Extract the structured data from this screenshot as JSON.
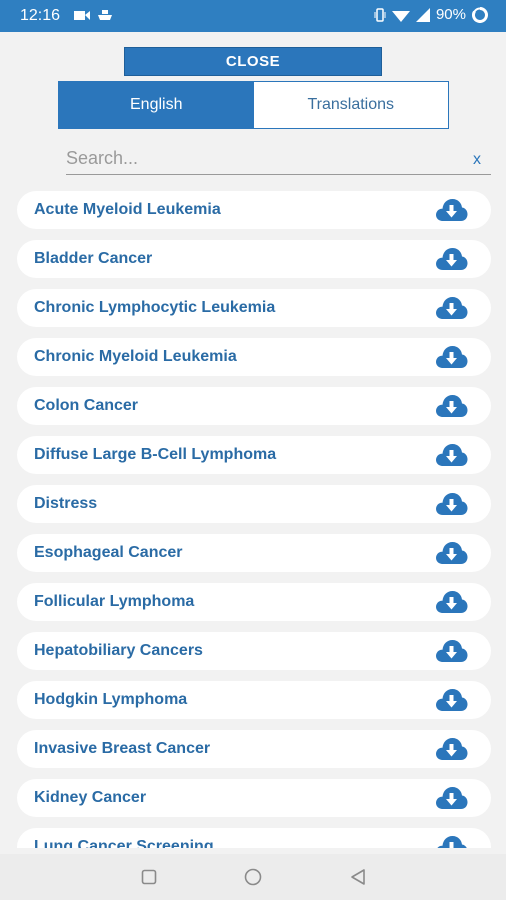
{
  "status": {
    "time": "12:16",
    "battery": "90%"
  },
  "close_label": "CLOSE",
  "tabs": [
    {
      "label": "English"
    },
    {
      "label": "Translations"
    }
  ],
  "search": {
    "placeholder": "Search...",
    "clear": "x"
  },
  "items": [
    {
      "label": "Acute Myeloid Leukemia"
    },
    {
      "label": "Bladder Cancer"
    },
    {
      "label": "Chronic Lymphocytic Leukemia"
    },
    {
      "label": "Chronic Myeloid Leukemia"
    },
    {
      "label": "Colon Cancer"
    },
    {
      "label": "Diffuse Large B-Cell Lymphoma"
    },
    {
      "label": "Distress"
    },
    {
      "label": "Esophageal Cancer"
    },
    {
      "label": "Follicular Lymphoma"
    },
    {
      "label": "Hepatobiliary Cancers"
    },
    {
      "label": "Hodgkin Lymphoma"
    },
    {
      "label": "Invasive Breast Cancer"
    },
    {
      "label": "Kidney Cancer"
    },
    {
      "label": "Lung Cancer Screening"
    }
  ],
  "colors": {
    "primary": "#2b76bb",
    "status_bar": "#2f7fc1",
    "text": "#2a6ba5"
  }
}
